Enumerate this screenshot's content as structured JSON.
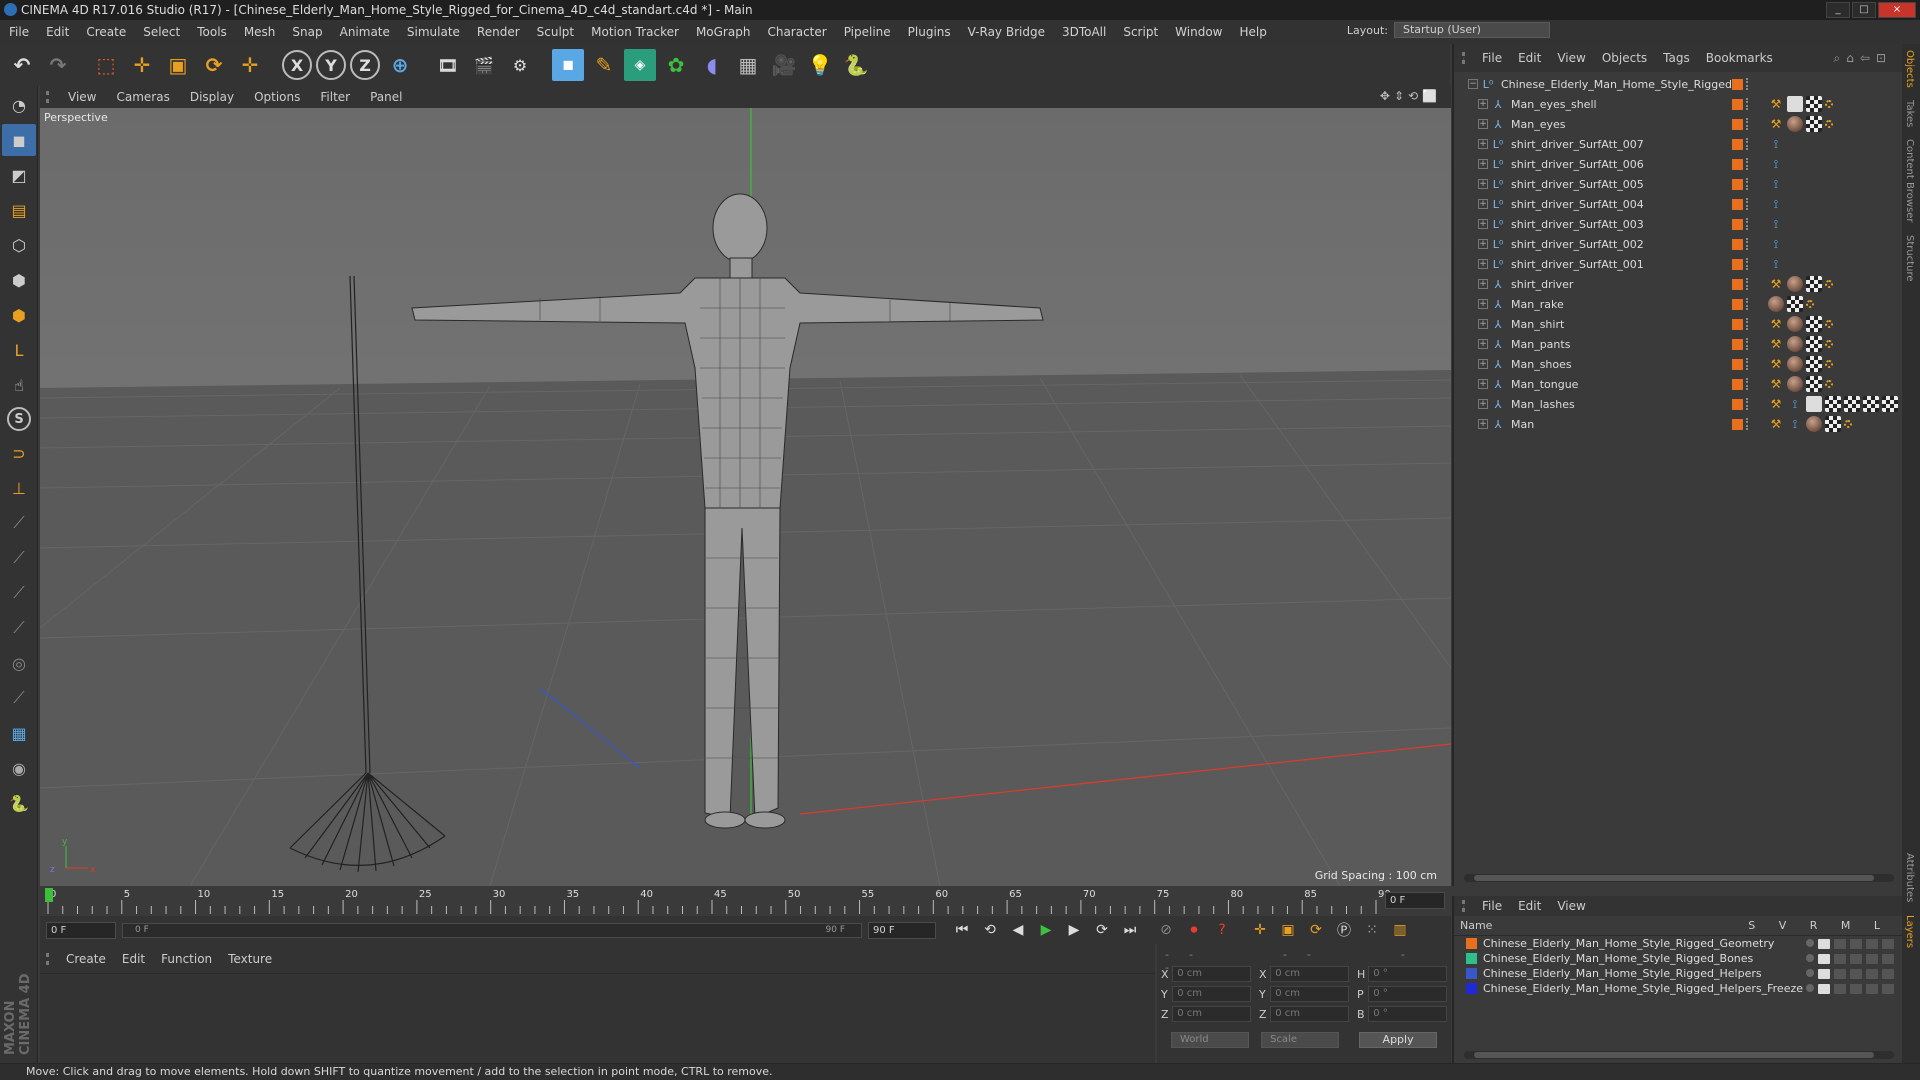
{
  "window": {
    "title": "CINEMA 4D R17.016 Studio (R17) - [Chinese_Elderly_Man_Home_Style_Rigged_for_Cinema_4D_c4d_standart.c4d *] - Main",
    "controls": [
      "_",
      "□",
      "×"
    ]
  },
  "menubar": {
    "items": [
      "File",
      "Edit",
      "Create",
      "Select",
      "Tools",
      "Mesh",
      "Snap",
      "Animate",
      "Simulate",
      "Render",
      "Sculpt",
      "Motion Tracker",
      "MoGraph",
      "Character",
      "Pipeline",
      "Plugins",
      "V-Ray Bridge",
      "3DToAll",
      "Script",
      "Window",
      "Help"
    ],
    "layout_label": "Layout:",
    "layout_value": "Startup (User)"
  },
  "toolbar": {
    "icons": [
      "undo-icon",
      "redo-icon",
      "live-selection-icon",
      "move-icon",
      "scale-icon",
      "rotate-icon",
      "last-tool-icon",
      "x-axis-icon",
      "y-axis-icon",
      "z-axis-icon",
      "coordinate-system-icon",
      "render-view-icon",
      "render-picture-viewer-icon",
      "edit-render-settings-icon",
      "cube-icon",
      "pen-spline-icon",
      "subdivision-icon",
      "array-icon",
      "deformer-icon",
      "floor-icon",
      "camera-icon",
      "light-icon",
      "python-icon"
    ],
    "axes": [
      "X",
      "Y",
      "Z"
    ]
  },
  "leftbar": {
    "icons": [
      "make-editable-icon",
      "model-mode-icon",
      "texture-mode-icon",
      "workplane-icon",
      "points-mode-icon",
      "edges-mode-icon",
      "polygons-mode-icon",
      "axis-icon",
      "tweak-icon",
      "snap-icon",
      "magnet-icon",
      "locked-workplane-icon",
      "joint-icon",
      "ik-icon",
      "weight-icon",
      "pose-icon",
      "cloth-icon",
      "hair-icon",
      "grid-icon",
      "layer-icon",
      "python-icon"
    ],
    "s_label": "S",
    "brand": "MAXON CINEMA 4D"
  },
  "viewport": {
    "menu": [
      "View",
      "Cameras",
      "Display",
      "Options",
      "Filter",
      "Panel"
    ],
    "label": "Perspective",
    "grid_spacing": "Grid Spacing : 100 cm",
    "axis_labels": [
      "y",
      "z",
      "x"
    ]
  },
  "timeline": {
    "ticks": [
      "0",
      "5",
      "10",
      "15",
      "20",
      "25",
      "30",
      "35",
      "40",
      "45",
      "50",
      "55",
      "60",
      "65",
      "70",
      "75",
      "80",
      "85",
      "90"
    ],
    "current_frame": "0 F"
  },
  "playback": {
    "start": "0 F",
    "range_start": "0 F",
    "range_end": "90 F",
    "end": "90 F",
    "buttons": [
      "go-to-start-icon",
      "previous-key-icon",
      "previous-frame-icon",
      "play-icon",
      "next-frame-icon",
      "next-key-icon",
      "go-to-end-icon"
    ]
  },
  "material_panel": {
    "menu": [
      "Create",
      "Edit",
      "Function",
      "Texture"
    ]
  },
  "coordinates": {
    "header": [
      "--",
      "--",
      "--"
    ],
    "rows": [
      {
        "a": "X",
        "v1": "0 cm",
        "b": "X",
        "v2": "0 cm",
        "c": "H",
        "v3": "0 °"
      },
      {
        "a": "Y",
        "v1": "0 cm",
        "b": "Y",
        "v2": "0 cm",
        "c": "P",
        "v3": "0 °"
      },
      {
        "a": "Z",
        "v1": "0 cm",
        "b": "Z",
        "v2": "0 cm",
        "c": "B",
        "v3": "0 °"
      }
    ],
    "mode1": "World",
    "mode2": "Scale",
    "apply": "Apply"
  },
  "object_manager": {
    "menu": [
      "File",
      "Edit",
      "View",
      "Objects",
      "Tags",
      "Bookmarks"
    ],
    "root": "Chinese_Elderly_Man_Home_Style_Rigged",
    "objects": [
      {
        "name": "Man_eyes_shell",
        "icon": "joint",
        "tags": [
          "bone",
          "white",
          "chk",
          "dot"
        ]
      },
      {
        "name": "Man_eyes",
        "icon": "joint",
        "tags": [
          "bone",
          "mat",
          "chk",
          "dot"
        ]
      },
      {
        "name": "shirt_driver_SurfAtt_007",
        "icon": "null",
        "tags": [
          "pin"
        ]
      },
      {
        "name": "shirt_driver_SurfAtt_006",
        "icon": "null",
        "tags": [
          "pin"
        ]
      },
      {
        "name": "shirt_driver_SurfAtt_005",
        "icon": "null",
        "tags": [
          "pin"
        ]
      },
      {
        "name": "shirt_driver_SurfAtt_004",
        "icon": "null",
        "tags": [
          "pin"
        ]
      },
      {
        "name": "shirt_driver_SurfAtt_003",
        "icon": "null",
        "tags": [
          "pin"
        ]
      },
      {
        "name": "shirt_driver_SurfAtt_002",
        "icon": "null",
        "tags": [
          "pin"
        ]
      },
      {
        "name": "shirt_driver_SurfAtt_001",
        "icon": "null",
        "tags": [
          "pin"
        ]
      },
      {
        "name": "shirt_driver",
        "icon": "joint",
        "tags": [
          "bone",
          "mat",
          "chk",
          "dot"
        ]
      },
      {
        "name": "Man_rake",
        "icon": "joint",
        "tags": [
          "mat",
          "chk",
          "dot"
        ]
      },
      {
        "name": "Man_shirt",
        "icon": "joint",
        "tags": [
          "bone",
          "mat",
          "chk",
          "dot"
        ]
      },
      {
        "name": "Man_pants",
        "icon": "joint",
        "tags": [
          "bone",
          "mat",
          "chk",
          "dot"
        ]
      },
      {
        "name": "Man_shoes",
        "icon": "joint",
        "tags": [
          "bone",
          "mat",
          "chk",
          "dot"
        ]
      },
      {
        "name": "Man_tongue",
        "icon": "joint",
        "tags": [
          "bone",
          "mat",
          "chk",
          "dot"
        ]
      },
      {
        "name": "Man_lashes",
        "icon": "joint",
        "tags": [
          "bone",
          "pin",
          "white",
          "chk",
          "chk",
          "chk",
          "chk"
        ]
      },
      {
        "name": "Man",
        "icon": "joint",
        "tags": [
          "bone",
          "pin",
          "mat",
          "chk",
          "dot"
        ]
      }
    ]
  },
  "layer_manager": {
    "menu": [
      "File",
      "Edit",
      "View"
    ],
    "name_header": "Name",
    "col_headers": "S V R M L",
    "layers": [
      {
        "name": "Chinese_Elderly_Man_Home_Style_Rigged_Geometry",
        "color": "#e8701c"
      },
      {
        "name": "Chinese_Elderly_Man_Home_Style_Rigged_Bones",
        "color": "#2fc08a"
      },
      {
        "name": "Chinese_Elderly_Man_Home_Style_Rigged_Helpers",
        "color": "#3a57c9"
      },
      {
        "name": "Chinese_Elderly_Man_Home_Style_Rigged_Helpers_Freeze",
        "color": "#1f2ad6"
      }
    ]
  },
  "side_tabs": [
    "Objects",
    "Takes",
    "Content Browser",
    "Structure",
    "Attributes",
    "Layers"
  ],
  "status": "Move: Click and drag to move elements. Hold down SHIFT to quantize movement / add to the selection in point mode, CTRL to remove."
}
